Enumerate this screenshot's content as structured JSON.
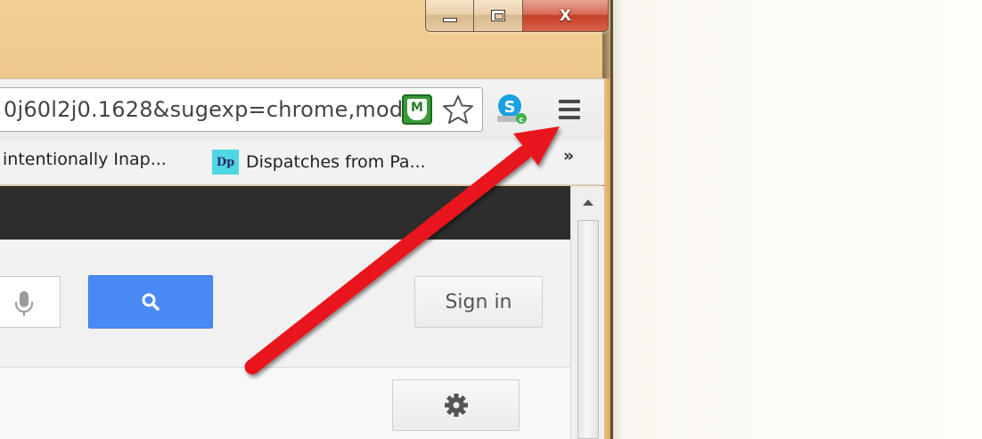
{
  "window": {
    "caption": {
      "minimize_icon": "minimize-icon",
      "maximize_icon": "maximize-icon",
      "close_label": "X"
    }
  },
  "toolbar": {
    "address_bar_value": "0j60l2j0.1628&sugexp=chrome,mod",
    "extensions": [
      "mcafee-siteadvisor-icon",
      "bookmark-star-icon",
      "skype-icon"
    ],
    "menu_icon": "hamburger-menu-icon"
  },
  "bookmarks_bar": {
    "items": [
      {
        "label": "intentionally Inap..."
      },
      {
        "label": "Dispatches from Pa...",
        "favicon_text": "Dp"
      }
    ],
    "overflow_label": "»"
  },
  "page": {
    "search_button_icon": "magnifier-icon",
    "sign_in_label": "Sign in",
    "settings_icon": "gear-icon",
    "mic_icon": "microphone-icon"
  },
  "annotation": {
    "arrow_color": "#e8191a"
  },
  "colors": {
    "frame": "#ebc181",
    "search_button": "#4a8af4",
    "close_button": "#c7412a",
    "google_bar": "#2d2d2d"
  }
}
